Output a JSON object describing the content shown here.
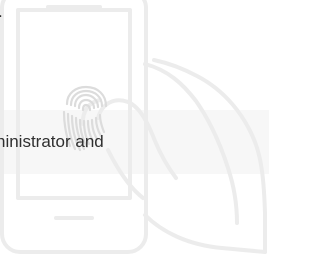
{
  "content": {
    "top_text": ".",
    "middle_text": "ninistrator and"
  },
  "icons": {
    "illustration": "phone-with-fingerprint-hand-icon"
  },
  "colors": {
    "text": "#2f2f2f",
    "illustration_stroke": "#eeeeee",
    "band_background": "#f7f7f7",
    "page_background": "#ffffff"
  }
}
